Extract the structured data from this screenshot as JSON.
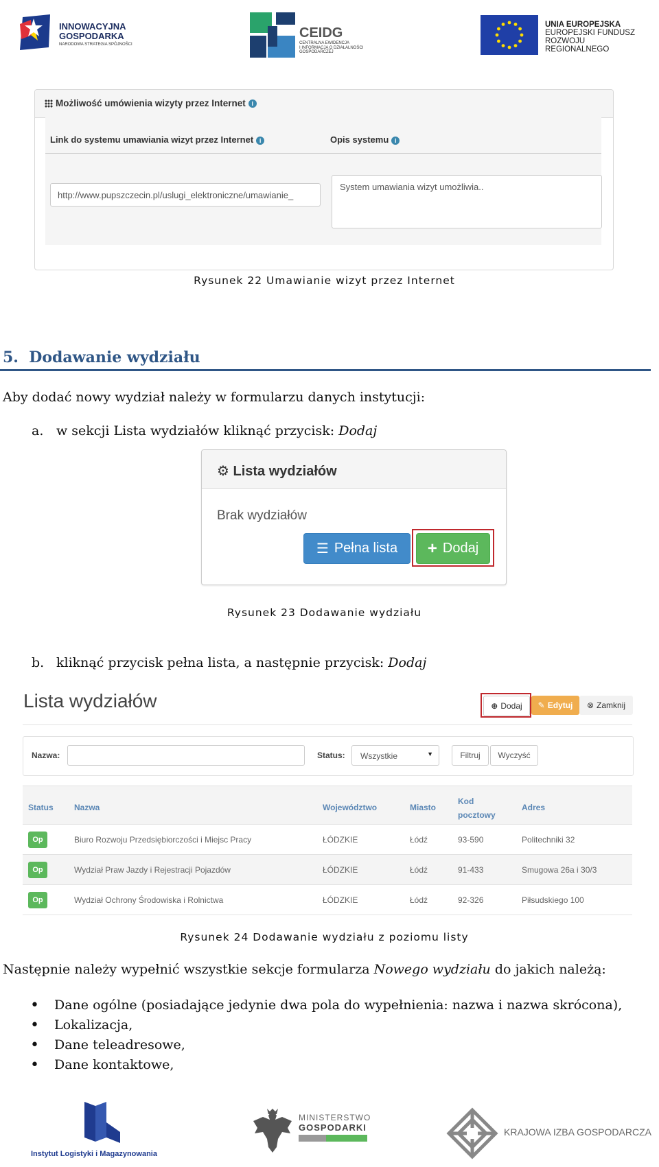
{
  "header_logos": {
    "left": {
      "title_line1": "INNOWACYJNA",
      "title_line2": "GOSPODARKA",
      "subtitle": "NARODOWA STRATEGIA SPÓJNOŚCI"
    },
    "center": {
      "title": "CEIDG",
      "subtitle_line1": "CENTRALNA EWIDENCJA",
      "subtitle_line2": "I INFORMACJA O DZIAŁALNOŚCI",
      "subtitle_line3": "GOSPODARCZEJ"
    },
    "right": {
      "line1": "UNIA EUROPEJSKA",
      "line2": "EUROPEJSKI FUNDUSZ",
      "line3": "ROZWOJU REGIONALNEGO"
    }
  },
  "figure22": {
    "panel_title": "Możliwość umówienia wizyty przez Internet",
    "link_label": "Link do systemu umawiania wizyt przez Internet",
    "link_value": "http://www.pupszczecin.pl/uslugi_elektroniczne/umawianie_",
    "desc_label": "Opis systemu",
    "desc_value": "System umawiania wizyt umożliwia..",
    "caption": "Rysunek 22 Umawianie wizyt przez Internet"
  },
  "section": {
    "number": "5.",
    "title": "Dodawanie wydziału",
    "intro": "Aby dodać nowy wydział należy w formularzu danych instytucji:"
  },
  "step_a": {
    "marker": "a.",
    "text": "w sekcji Lista wydziałów kliknąć przycisk: ",
    "emph": "Dodaj"
  },
  "figure23": {
    "panel_title": "Lista wydziałów",
    "empty_text": "Brak wydziałów",
    "full_list_button": "Pełna lista",
    "add_button": "Dodaj",
    "caption": "Rysunek 23 Dodawanie wydziału"
  },
  "step_b": {
    "marker": "b.",
    "text": "kliknąć przycisk pełna lista, a następnie przycisk: ",
    "emph": "Dodaj"
  },
  "figure24": {
    "page_title": "Lista wydziałów",
    "toolbar": {
      "add": "Dodaj",
      "edit": "Edytuj",
      "close": "Zamknij"
    },
    "filters": {
      "name_label": "Nazwa:",
      "status_label": "Status:",
      "status_value": "Wszystkie",
      "filter_button": "Filtruj",
      "clear_button": "Wyczyść"
    },
    "columns": {
      "status": "Status",
      "name": "Nazwa",
      "voivodeship": "Województwo",
      "city": "Miasto",
      "postal_line1": "Kod",
      "postal_line2": "pocztowy",
      "address": "Adres"
    },
    "rows": [
      {
        "status": "Op",
        "name": "Biuro Rozwoju Przedsiębiorczości i Miejsc Pracy",
        "voivodeship": "ŁÓDZKIE",
        "city": "Łódź",
        "postal": "93-590",
        "address": "Politechniki 32"
      },
      {
        "status": "Op",
        "name": "Wydział Praw Jazdy i Rejestracji Pojazdów",
        "voivodeship": "ŁÓDZKIE",
        "city": "Łódź",
        "postal": "91-433",
        "address": "Smugowa 26a i 30/3"
      },
      {
        "status": "Op",
        "name": "Wydział Ochrony Środowiska i Rolnictwa",
        "voivodeship": "ŁÓDZKIE",
        "city": "Łódź",
        "postal": "92-326",
        "address": "Piłsudskiego 100"
      }
    ],
    "caption": "Rysunek 24 Dodawanie wydziału z poziomu listy"
  },
  "closing": {
    "text_before": "Następnie należy wypełnić wszystkie sekcje formularza ",
    "emph": "Nowego wydziału",
    "text_after": " do jakich należą:",
    "bullets": [
      "Dane ogólne (posiadające jedynie dwa pola do wypełnienia: nazwa i nazwa skrócona),",
      "Lokalizacja,",
      "Dane teleadresowe,",
      "Dane kontaktowe,"
    ]
  },
  "footer_logos": {
    "ilim": "Instytut Logistyki i Magazynowania",
    "ministry_line1": "MINISTERSTWO",
    "ministry_line2": "GOSPODARKI",
    "kig": "KRAJOWA IZBA GOSPODARCZA"
  },
  "colors": {
    "heading_blue": "#2f5686",
    "primary_btn": "#428bca",
    "success_btn": "#5cb85c",
    "warning_btn": "#f0ad4e",
    "highlight_red": "#c0282d"
  }
}
